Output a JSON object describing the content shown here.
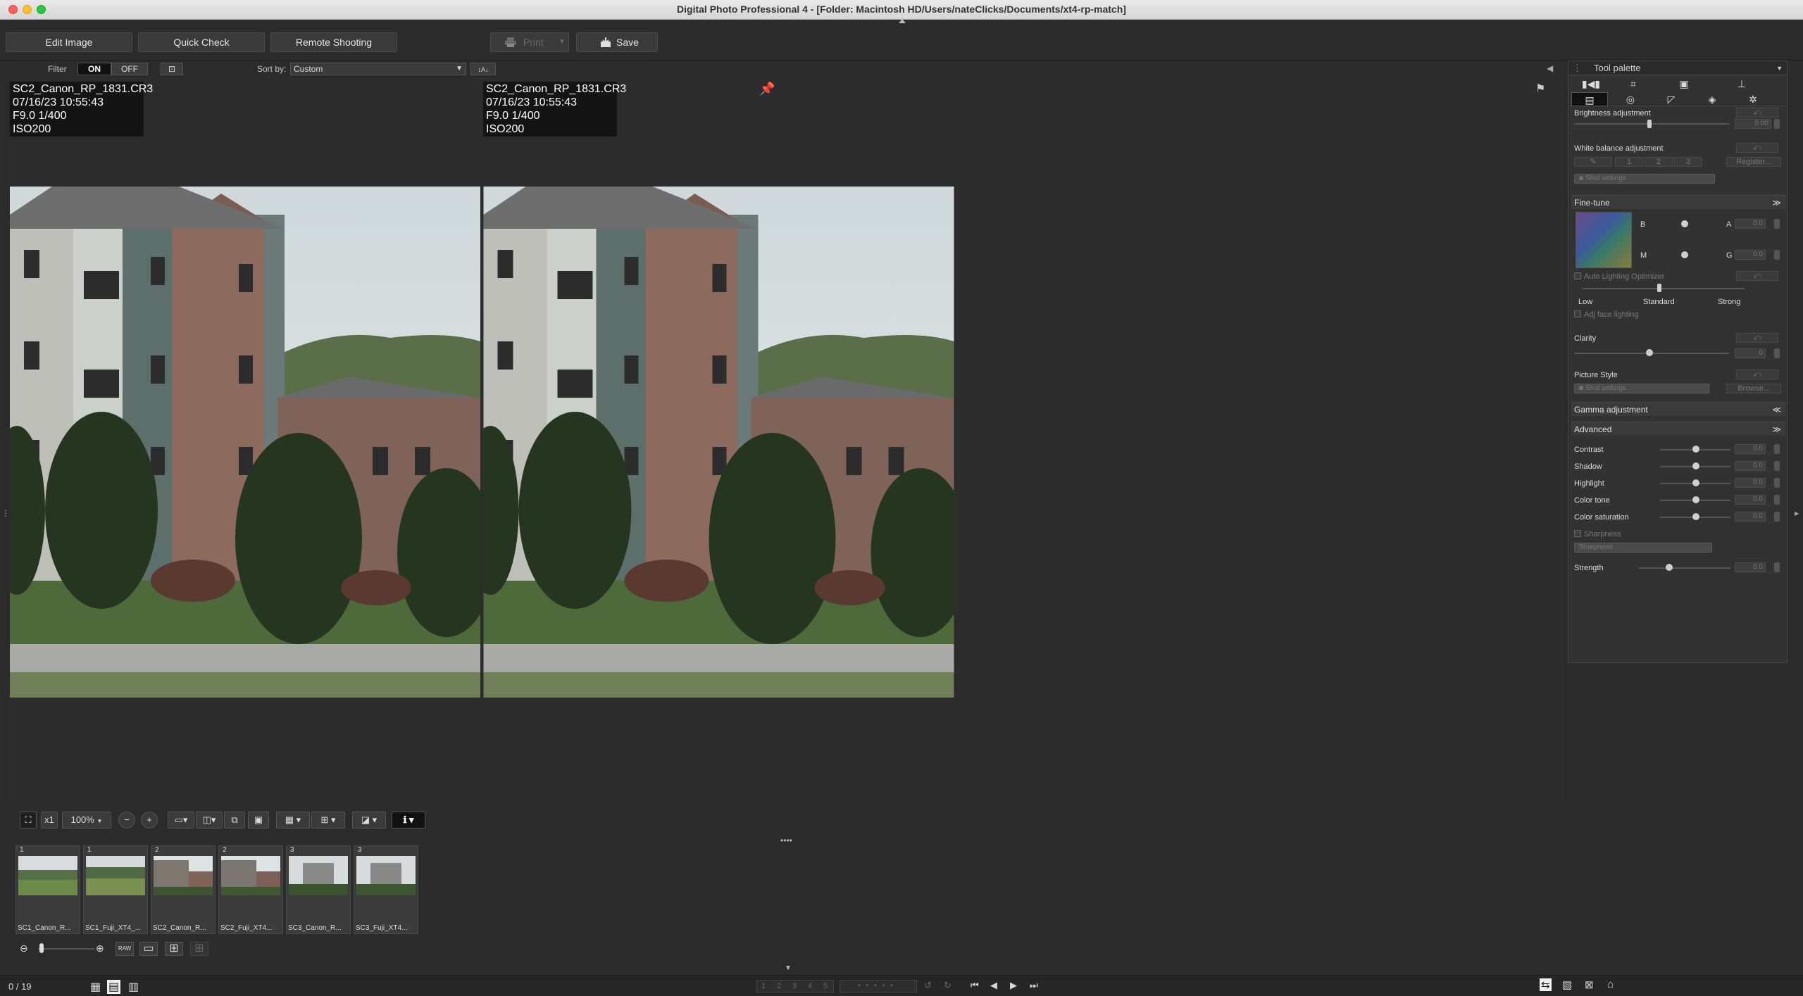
{
  "window": {
    "title": "Digital Photo Professional 4 - [Folder: Macintosh HD/Users/nateClicks/Documents/xt4-rp-match]"
  },
  "toolbar": {
    "edit_image": "Edit Image",
    "quick_check": "Quick Check",
    "remote_shooting": "Remote Shooting",
    "print": "Print",
    "save": "Save"
  },
  "filterbar": {
    "filter_label": "Filter",
    "on": "ON",
    "off": "OFF",
    "sort_label": "Sort by:",
    "sort_value": "Custom"
  },
  "viewer": {
    "left": {
      "l1": "SC2_Canon_RP_1831.CR3",
      "l2": "07/16/23 10:55:43",
      "l3": "F9.0 1/400",
      "l4": "ISO200"
    },
    "right": {
      "l1": "SC2_Canon_RP_1831.CR3",
      "l2": "07/16/23 10:55:43",
      "l3": "F9.0 1/400",
      "l4": "ISO200"
    }
  },
  "zoombar": {
    "x1": "x1",
    "zoom": "100%"
  },
  "filmstrip": {
    "thumbs": [
      {
        "caption": "SC1_Canon_R...",
        "rating": "1"
      },
      {
        "caption": "SC1_Fuji_XT4_...",
        "rating": "1"
      },
      {
        "caption": "SC2_Canon_R...",
        "rating": "2"
      },
      {
        "caption": "SC2_Fuji_XT4...",
        "rating": "2"
      },
      {
        "caption": "SC3_Canon_R...",
        "rating": "3"
      },
      {
        "caption": "SC3_Fuji_XT4...",
        "rating": "3"
      }
    ]
  },
  "status": {
    "count": "0 / 19",
    "ratings": [
      "1",
      "2",
      "3",
      "4",
      "5"
    ]
  },
  "palette": {
    "title": "Tool palette",
    "brightness": "Brightness adjustment",
    "brightness_value": "0.00",
    "white_balance": "White balance adjustment",
    "wb_buttons": [
      "1",
      "2",
      "3"
    ],
    "register": "Register...",
    "shot_settings": "Shot settings",
    "fine_tune": "Fine-tune",
    "b": "B",
    "a": "A",
    "m": "M",
    "g": "G",
    "a_value": "0.0",
    "g_value": "0.0",
    "alo": "Auto Lighting Optimizer",
    "low": "Low",
    "standard": "Standard",
    "strong": "Strong",
    "adj_face": "Adj face lighting",
    "clarity": "Clarity",
    "clarity_value": "0",
    "picture_style": "Picture Style",
    "ps_value": "Shot settings",
    "browse": "Browse...",
    "gamma": "Gamma adjustment",
    "advanced": "Advanced",
    "contrast": "Contrast",
    "shadow": "Shadow",
    "highlight": "Highlight",
    "color_tone": "Color tone",
    "color_saturation": "Color saturation",
    "adv_value": "0.0",
    "sharpness_chk": "Sharpness",
    "sharpness_sel": "Sharpness",
    "strength": "Strength",
    "strength_value": "0.0"
  }
}
